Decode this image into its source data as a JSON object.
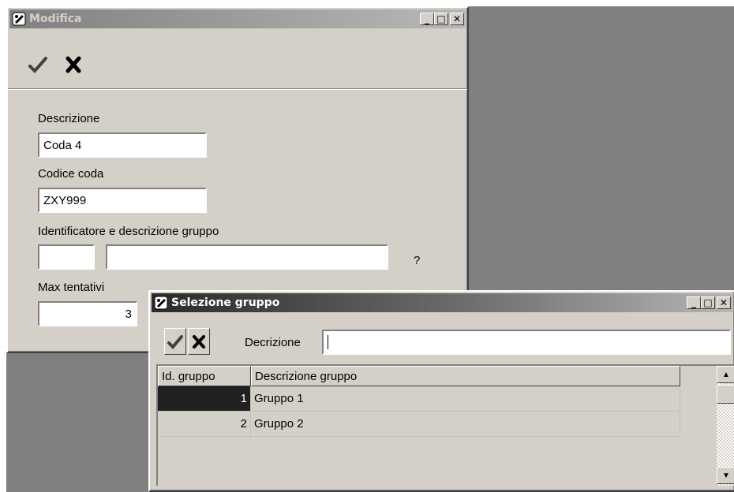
{
  "modifica": {
    "title": "Modifica",
    "toolbar": {
      "confirm_icon": "checkmark-icon",
      "cancel_icon": "x-icon"
    },
    "fields": {
      "descrizione_label": "Descrizione",
      "descrizione_value": "Coda 4",
      "codice_label": "Codice coda",
      "codice_value": "ZXY999",
      "gruppo_label": "Identificatore e descrizione gruppo",
      "gruppo_id_value": "",
      "gruppo_desc_value": "",
      "gruppo_lookup": "?",
      "max_label": "Max tentativi",
      "max_value": "3"
    },
    "controls": {
      "minimize": "_",
      "maximize": "□",
      "close": "✕"
    }
  },
  "selezione": {
    "title": "Selezione gruppo",
    "search_label": "Decrizione",
    "search_value": "",
    "columns": [
      "Id. gruppo",
      "Descrizione gruppo"
    ],
    "rows": [
      {
        "id": "1",
        "desc": "Gruppo 1",
        "selected": true
      },
      {
        "id": "2",
        "desc": "Gruppo 2",
        "selected": false
      }
    ],
    "controls": {
      "minimize": "_",
      "maximize": "□",
      "close": "✕"
    },
    "scroll_up": "▲",
    "scroll_down": "▼"
  },
  "colors": {
    "desktop": "#808080",
    "window_face": "#d4d0c8",
    "selected_row": "#202020"
  }
}
